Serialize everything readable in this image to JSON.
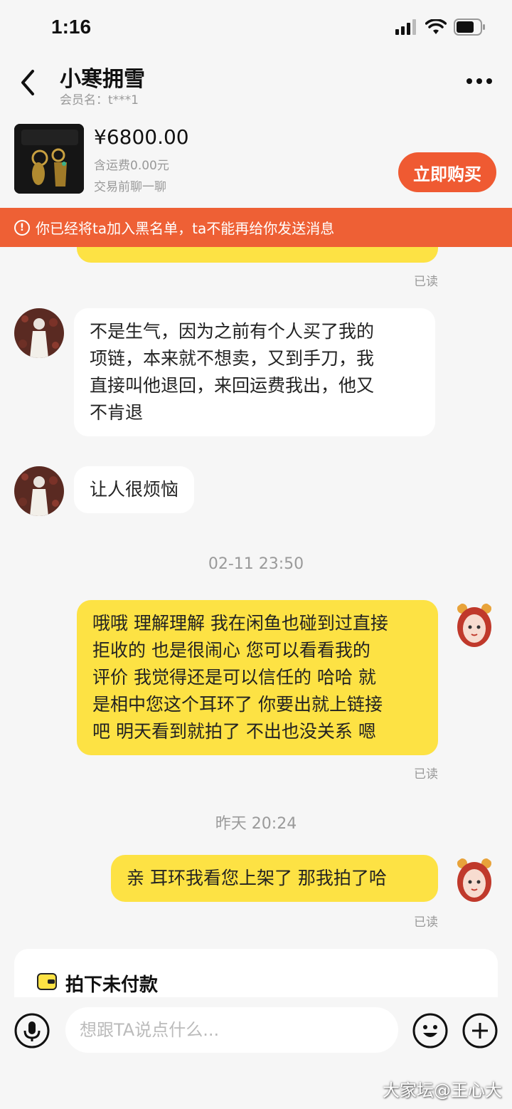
{
  "status_bar": {
    "time": "1:16"
  },
  "header": {
    "title": "小寒拥雪",
    "member": "会员名：t***1"
  },
  "product": {
    "price": "¥6800.00",
    "shipping": "含运费0.00元",
    "chat_hint": "交易前聊一聊",
    "buy_label": "立即购买"
  },
  "banner": {
    "text": "你已经将ta加入黑名单，ta不能再给你发送消息",
    "color": "#ee6035"
  },
  "messages": {
    "m0_read": "已读",
    "m1_line1": "不是生气，因为之前有个人买了我的",
    "m1_line2": "项链，本来就不想卖，又到手刀，我",
    "m1_line3": "直接叫他退回，来回运费我出，他又",
    "m1_line4": "不肯退",
    "m2_text": "让人很烦恼",
    "ts1": "02-11 23:50",
    "m3_line1": "哦哦 理解理解 我在闲鱼也碰到过直接",
    "m3_line2": "拒收的  也是很闹心  您可以看看我的",
    "m3_line3": "评价 我觉得还是可以信任的 哈哈 就",
    "m3_line4": "是相中您这个耳环了 你要出就上链接",
    "m3_line5": "吧 明天看到就拍了 不出也没关系   嗯",
    "m3_read": "已读",
    "ts2": "昨天 20:24",
    "m4_text": "亲 耳环我看您上架了 那我拍了哈",
    "m4_read": "已读"
  },
  "order_card": {
    "title": "拍下未付款"
  },
  "input": {
    "placeholder": "想跟TA说点什么..."
  },
  "watermark": "大家坛@王心大",
  "colors": {
    "accent": "#ef5a32",
    "bubble_self": "#fde244",
    "background": "#f6f6f6"
  }
}
